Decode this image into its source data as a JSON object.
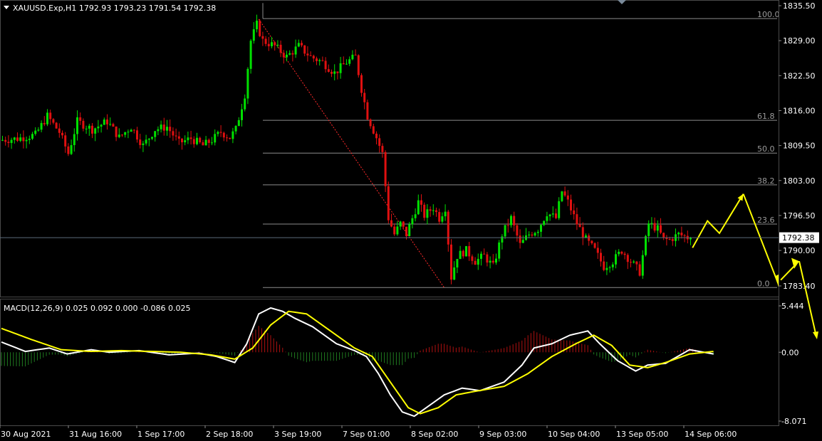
{
  "chart_data": [
    {
      "type": "candlestick",
      "symbol_info": "XAUUSD.Exp,H1  1792.93 1793.23 1791.54 1792.38",
      "current_price_label": "1792.38",
      "current_price": 1792.38,
      "ylim": [
        1781.0,
        1836.5
      ],
      "y_ticks": [
        "1835.50",
        "1829.00",
        "1822.50",
        "1816.00",
        "1809.50",
        "1803.00",
        "1796.50",
        "1790.00",
        "1783.40"
      ],
      "x_ticks": [
        "30 Aug 2021",
        "31 Aug 16:00",
        "1 Sep 17:00",
        "2 Sep 18:00",
        "3 Sep 19:00",
        "7 Sep 01:00",
        "8 Sep 02:00",
        "9 Sep 03:00",
        "10 Sep 04:00",
        "13 Sep 05:00",
        "14 Sep 06:00"
      ],
      "fibonacci": {
        "levels": [
          {
            "label": "100.0",
            "price": 1833.1
          },
          {
            "label": "61.8",
            "price": 1814.2
          },
          {
            "label": "50.0",
            "price": 1808.1
          },
          {
            "label": "38.2",
            "price": 1802.2
          },
          {
            "label": "23.6",
            "price": 1794.9
          },
          {
            "label": "0.0",
            "price": 1783.1
          }
        ]
      },
      "colors": {
        "up": "#00e000",
        "down": "#e01010",
        "fib": "#8c8c8c",
        "trend": "#ff2a2a",
        "forecast": "#ffff00",
        "price_line": "#6a7a8a"
      },
      "price_path": [
        [
          0,
          1810.5
        ],
        [
          6,
          1810.8
        ],
        [
          12,
          1811.5
        ],
        [
          16,
          1815
        ],
        [
          20,
          1812
        ],
        [
          23,
          1808
        ],
        [
          26,
          1814
        ],
        [
          31,
          1812.5
        ],
        [
          36,
          1814
        ],
        [
          40,
          1811
        ],
        [
          44,
          1813
        ],
        [
          48,
          1809.5
        ],
        [
          52,
          1812.5
        ],
        [
          56,
          1813
        ],
        [
          60,
          1810
        ],
        [
          64,
          1810.8
        ],
        [
          68,
          1809.5
        ],
        [
          71,
          1810.5
        ],
        [
          74,
          1812
        ],
        [
          77,
          1811
        ],
        [
          79,
          1812.5
        ],
        [
          82,
          1819
        ],
        [
          84,
          1829
        ],
        [
          86,
          1832
        ],
        [
          88,
          1829
        ],
        [
          92,
          1828
        ],
        [
          96,
          1826
        ],
        [
          100,
          1828
        ],
        [
          104,
          1826
        ],
        [
          108,
          1825
        ],
        [
          112,
          1823
        ],
        [
          116,
          1825
        ],
        [
          119,
          1826
        ],
        [
          121,
          1820
        ],
        [
          123,
          1815
        ],
        [
          126,
          1811
        ],
        [
          128,
          1808
        ],
        [
          130,
          1796
        ],
        [
          132,
          1793
        ],
        [
          134,
          1795
        ],
        [
          136,
          1793
        ],
        [
          138,
          1796
        ],
        [
          140,
          1799
        ],
        [
          142,
          1796.5
        ],
        [
          145,
          1798
        ],
        [
          147,
          1796
        ],
        [
          149,
          1798
        ],
        [
          151,
          1785
        ],
        [
          153,
          1789
        ],
        [
          156,
          1790
        ],
        [
          159,
          1788
        ],
        [
          162,
          1789
        ],
        [
          165,
          1787
        ],
        [
          168,
          1793
        ],
        [
          171,
          1796
        ],
        [
          174,
          1791
        ],
        [
          177,
          1793
        ],
        [
          180,
          1794
        ],
        [
          183,
          1797
        ],
        [
          186,
          1796
        ],
        [
          188,
          1801
        ],
        [
          190,
          1799
        ],
        [
          193,
          1795
        ],
        [
          196,
          1792
        ],
        [
          199,
          1790
        ],
        [
          202,
          1787
        ],
        [
          205,
          1788
        ],
        [
          208,
          1790
        ],
        [
          211,
          1788
        ],
        [
          214,
          1786
        ],
        [
          217,
          1795
        ],
        [
          220,
          1794
        ],
        [
          222,
          1792
        ],
        [
          224,
          1792
        ],
        [
          227,
          1793
        ],
        [
          230,
          1792.4
        ]
      ],
      "forecast_path": [
        [
          231,
          1790.5
        ],
        [
          236,
          1795.5
        ],
        [
          240,
          1793.2
        ],
        [
          248,
          1800.5
        ]
      ],
      "forecast_drop": [
        [
          248,
          1800.5
        ],
        [
          257,
          1785
        ]
      ]
    },
    {
      "type": "macd",
      "label": "MACD(12,26,9) 0.025 0.092 0.000 -0.086 0.025",
      "ylim": [
        -8.071,
        5.444
      ],
      "y_ticks": [
        "5.444",
        "0.00",
        "-8.071"
      ],
      "macd_path": [
        [
          0,
          1.2
        ],
        [
          8,
          0.1
        ],
        [
          16,
          0.5
        ],
        [
          22,
          -0.2
        ],
        [
          30,
          0.3
        ],
        [
          36,
          0
        ],
        [
          46,
          0.2
        ],
        [
          56,
          -0.3
        ],
        [
          66,
          -0.1
        ],
        [
          72,
          -0.5
        ],
        [
          78,
          -1.2
        ],
        [
          82,
          1.0
        ],
        [
          86,
          4.5
        ],
        [
          90,
          5.2
        ],
        [
          94,
          4.8
        ],
        [
          98,
          4.0
        ],
        [
          104,
          3.0
        ],
        [
          112,
          1.0
        ],
        [
          118,
          0.2
        ],
        [
          122,
          -0.5
        ],
        [
          126,
          -2.5
        ],
        [
          130,
          -5.0
        ],
        [
          134,
          -7.0
        ],
        [
          138,
          -7.5
        ],
        [
          142,
          -6.5
        ],
        [
          148,
          -5.0
        ],
        [
          154,
          -4.2
        ],
        [
          160,
          -4.5
        ],
        [
          168,
          -3.5
        ],
        [
          174,
          -1.5
        ],
        [
          178,
          0.5
        ],
        [
          184,
          1.0
        ],
        [
          190,
          2.0
        ],
        [
          196,
          2.5
        ],
        [
          200,
          1.0
        ],
        [
          206,
          -1.0
        ],
        [
          212,
          -2.2
        ],
        [
          216,
          -1.5
        ],
        [
          222,
          -1.3
        ],
        [
          226,
          -0.5
        ],
        [
          230,
          0.3
        ],
        [
          238,
          -0.2
        ]
      ],
      "signal_path": [
        [
          0,
          2.8
        ],
        [
          10,
          1.5
        ],
        [
          20,
          0.3
        ],
        [
          30,
          0.1
        ],
        [
          40,
          0.2
        ],
        [
          50,
          0.1
        ],
        [
          60,
          0
        ],
        [
          70,
          -0.3
        ],
        [
          78,
          -0.8
        ],
        [
          84,
          0.5
        ],
        [
          90,
          3.2
        ],
        [
          96,
          4.8
        ],
        [
          102,
          4.5
        ],
        [
          110,
          2.5
        ],
        [
          118,
          0.5
        ],
        [
          124,
          -0.5
        ],
        [
          130,
          -3.5
        ],
        [
          136,
          -6.5
        ],
        [
          140,
          -7.2
        ],
        [
          146,
          -6.5
        ],
        [
          152,
          -5.0
        ],
        [
          158,
          -4.6
        ],
        [
          168,
          -4.0
        ],
        [
          176,
          -2.5
        ],
        [
          184,
          -0.5
        ],
        [
          192,
          1.0
        ],
        [
          198,
          2.0
        ],
        [
          204,
          0.8
        ],
        [
          210,
          -1.5
        ],
        [
          216,
          -1.8
        ],
        [
          222,
          -1.2
        ],
        [
          230,
          -0.2
        ],
        [
          238,
          0.1
        ]
      ]
    }
  ]
}
